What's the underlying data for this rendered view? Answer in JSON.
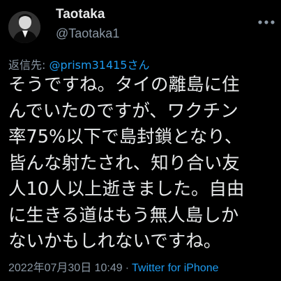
{
  "author": {
    "display_name": "Taotaka",
    "handle": "@Taotaka1",
    "avatar_icon": "profile-photo"
  },
  "reply": {
    "prefix": "返信先: ",
    "to_handle": "@prism31415さん"
  },
  "tweet": {
    "text": "そうですね。タイの離島に住\nんでいたのですが、ワクチン\n率75%以下で島封鎖となり、\n皆んな射たされ、知り合い友\n人10人以上逝きました。自由\nに生きる道はもう無人島しか\nないかもしれないですね。"
  },
  "meta": {
    "timestamp": "2022年07月30日 10:49",
    "separator": "·",
    "source": "Twitter for iPhone"
  },
  "icons": {
    "more": "more-horizontal-icon"
  },
  "colors": {
    "background": "#000000",
    "text_primary": "#e7e9ea",
    "text_secondary": "#8b98a5",
    "accent": "#1d9bf0"
  }
}
